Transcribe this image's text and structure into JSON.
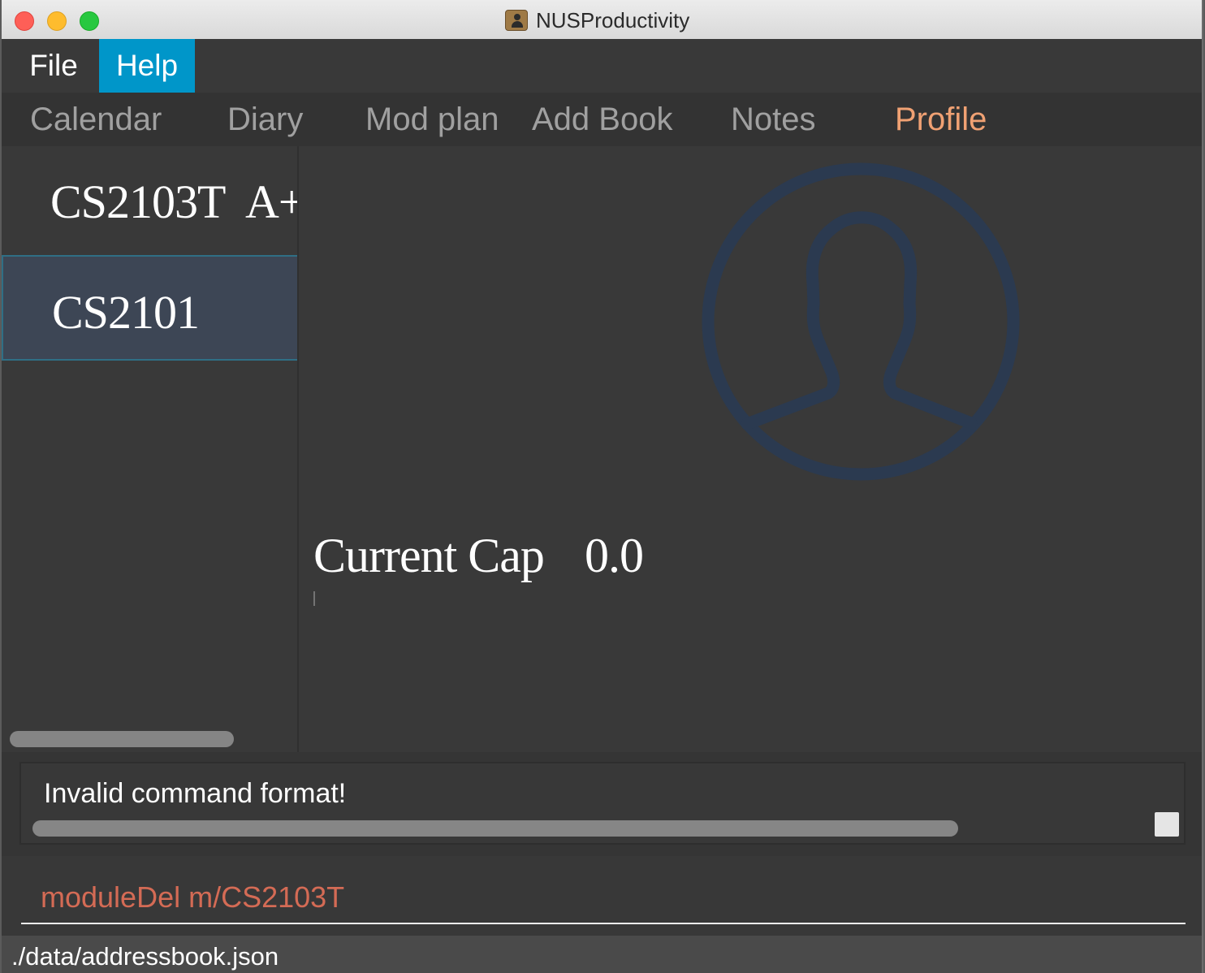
{
  "window": {
    "title": "NUSProductivity",
    "icon": "contacts-app-icon"
  },
  "menu": {
    "items": [
      {
        "label": "File",
        "active": false
      },
      {
        "label": "Help",
        "active": true
      }
    ]
  },
  "tabs": [
    {
      "label": "Calendar",
      "active": false
    },
    {
      "label": "Diary",
      "active": false
    },
    {
      "label": "Mod plan",
      "active": false
    },
    {
      "label": "Add Book",
      "active": false
    },
    {
      "label": "Notes",
      "active": false
    },
    {
      "label": "Profile",
      "active": true
    }
  ],
  "modules": [
    {
      "code": "CS2103T",
      "grade": "A+",
      "selected": false
    },
    {
      "code": "CS2101",
      "grade": "",
      "selected": true
    }
  ],
  "profile": {
    "avatar_icon": "person-silhouette-icon",
    "cap_label": "Current Cap",
    "cap_value": "0.0"
  },
  "result": {
    "message": "Invalid command format!"
  },
  "command": {
    "value": "moduleDel m/CS2103T",
    "placeholder": ""
  },
  "status": {
    "path": "./data/addressbook.json"
  },
  "colors": {
    "background": "#393939",
    "menu_highlight": "#0096c9",
    "active_tab": "#f0a173",
    "selected_row": "#3d4655",
    "command_text": "#d46b55"
  }
}
